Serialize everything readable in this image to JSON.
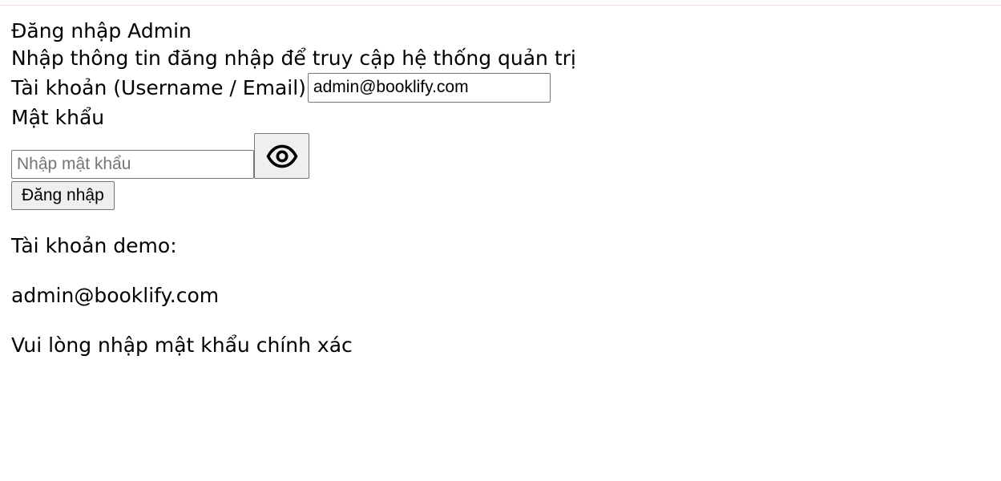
{
  "header": {
    "title": "Đăng nhập Admin",
    "subtitle": "Nhập thông tin đăng nhập để truy cập hệ thống quản trị"
  },
  "form": {
    "username_label": "Tài khoản (Username / Email)",
    "username_value": "admin@booklify.com",
    "password_label": "Mật khẩu",
    "password_placeholder": "Nhập mật khẩu",
    "password_value": "",
    "toggle_icon": "eye-icon",
    "submit_label": "Đăng nhập"
  },
  "demo": {
    "title": "Tài khoản demo:",
    "email": "admin@booklify.com"
  },
  "error": {
    "message": "Vui lòng nhập mật khẩu chính xác"
  },
  "colors": {
    "top_rule": "#f6dada",
    "button_bg": "#efefef",
    "border": "#767676"
  }
}
